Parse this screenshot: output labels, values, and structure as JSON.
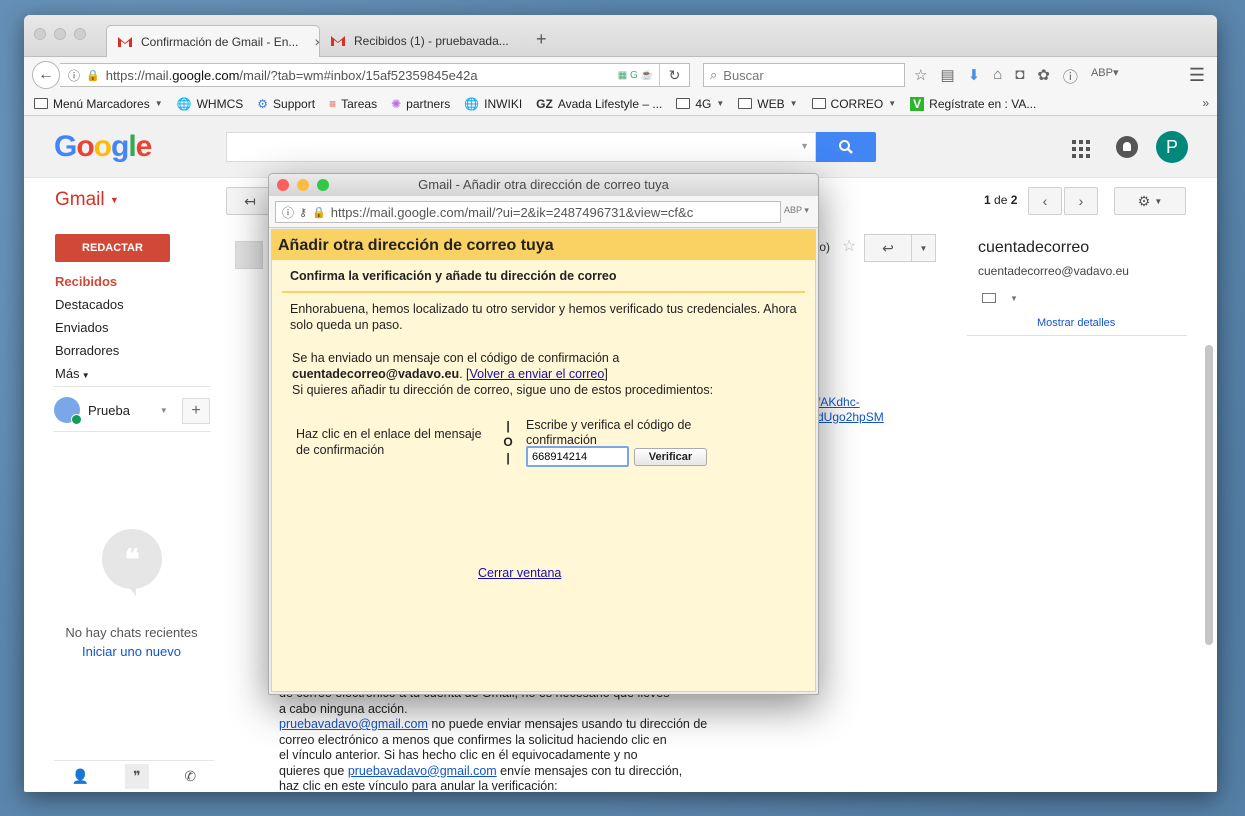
{
  "browser": {
    "tabs": [
      {
        "label": "Confirmación de Gmail - En..."
      },
      {
        "label": "Recibidos (1) - pruebavada..."
      }
    ],
    "url_prefix": "https://mail.",
    "url_host": "google.com",
    "url_path": "/mail/?tab=wm#inbox/15af52359845e42a",
    "search_placeholder": "Buscar",
    "bookmarks": [
      {
        "label": "Menú Marcadores",
        "type": "folder",
        "dropdown": true
      },
      {
        "label": "WHMCS",
        "type": "site"
      },
      {
        "label": "Support",
        "type": "site"
      },
      {
        "label": "Tareas",
        "type": "site"
      },
      {
        "label": "partners",
        "type": "site"
      },
      {
        "label": "INWIKI",
        "type": "site"
      },
      {
        "label": "Avada Lifestyle – ...",
        "type": "site"
      },
      {
        "label": "4G",
        "type": "folder",
        "dropdown": true
      },
      {
        "label": "WEB",
        "type": "folder",
        "dropdown": true
      },
      {
        "label": "CORREO",
        "type": "folder",
        "dropdown": true
      },
      {
        "label": "Regístrate en : VA...",
        "type": "site"
      }
    ]
  },
  "google": {
    "logo": "Google",
    "avatar_letter": "P"
  },
  "gmail": {
    "label": "Gmail",
    "compose": "REDACTAR",
    "folders": [
      "Recibidos",
      "Destacados",
      "Enviados",
      "Borradores",
      "Más"
    ],
    "chat_user": "Prueba",
    "no_chats": "No hay chats recientes",
    "start_new": "Iniciar uno nuevo",
    "pager_current": "1",
    "pager_sep": " de ",
    "pager_total": "2",
    "msg_meta": "to)",
    "sidebar_name": "cuentadecorreo",
    "sidebar_email": "cuentadecorreo@vadavo.eu",
    "sidebar_details": "Mostrar detalles",
    "link_frag_1": "fAKdhc-",
    "link_frag_2": "dUgo2hpSM",
    "body_line0": "de correo electrónico a tu cuenta de Gmail, no es necesario que lleves",
    "body_line1": "a cabo ninguna acción.",
    "body_link": "pruebavadavo@gmail.com",
    "body_line2a": " no puede enviar mensajes usando tu dirección de",
    "body_line3": "correo electrónico a menos que confirmes la solicitud haciendo clic en",
    "body_line4": "el vínculo anterior. Si has hecho clic en él equivocadamente y no",
    "body_line5a": "quieres que ",
    "body_line5b": " envíe mensajes con tu dirección,",
    "body_line6": "haz clic en este vínculo para anular la verificación:"
  },
  "popup": {
    "window_title": "Gmail - Añadir otra dirección de correo tuya",
    "url": "https://mail.google.com/mail/?ui=2&ik=2487496731&view=cf&c",
    "heading": "Añadir otra dirección de correo tuya",
    "subheading": "Confirma la verificación y añade tu dirección de correo",
    "p1": "Enhorabuena, hemos localizado tu otro servidor y hemos verificado tus credenciales. Ahora solo queda un paso.",
    "p2_line1": "Se ha enviado un mensaje con el código de confirmación a",
    "p2_email": "cuentadecorreo@vadavo.eu",
    "p2_after": ". [",
    "p2_resend": "Volver a enviar el correo",
    "p2_close_bracket": "]",
    "p2_line3": "Si quieres añadir tu dirección de correo, sigue uno de estos procedimientos:",
    "opt_left": "Haz clic en el enlace del mensaje de confirmación",
    "opt_or_1": "|",
    "opt_or_2": "O",
    "opt_or_3": "|",
    "opt_right": "Escribe y verifica el código de confirmación",
    "code_value": "668914214",
    "verify_label": "Verificar",
    "close_label": "Cerrar ventana"
  },
  "colors": {
    "gmail_red": "#d14836",
    "google_blue": "#4285f4",
    "popup_header": "#fad163",
    "popup_bg": "#fff7d6",
    "avatar_bg": "#00897b"
  }
}
